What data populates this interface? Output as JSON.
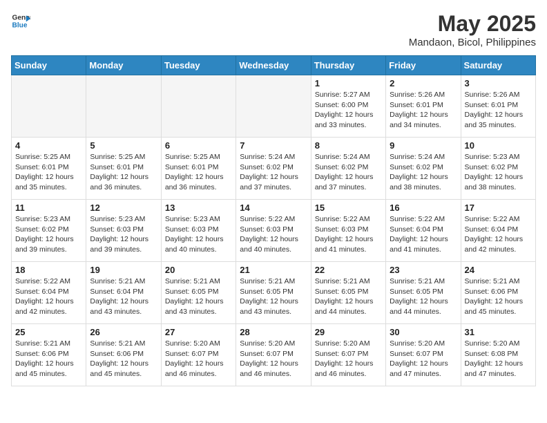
{
  "header": {
    "logo_line1": "General",
    "logo_line2": "Blue",
    "month": "May 2025",
    "location": "Mandaon, Bicol, Philippines"
  },
  "weekdays": [
    "Sunday",
    "Monday",
    "Tuesday",
    "Wednesday",
    "Thursday",
    "Friday",
    "Saturday"
  ],
  "weeks": [
    [
      {
        "day": "",
        "info": ""
      },
      {
        "day": "",
        "info": ""
      },
      {
        "day": "",
        "info": ""
      },
      {
        "day": "",
        "info": ""
      },
      {
        "day": "1",
        "info": "Sunrise: 5:27 AM\nSunset: 6:00 PM\nDaylight: 12 hours\nand 33 minutes."
      },
      {
        "day": "2",
        "info": "Sunrise: 5:26 AM\nSunset: 6:01 PM\nDaylight: 12 hours\nand 34 minutes."
      },
      {
        "day": "3",
        "info": "Sunrise: 5:26 AM\nSunset: 6:01 PM\nDaylight: 12 hours\nand 35 minutes."
      }
    ],
    [
      {
        "day": "4",
        "info": "Sunrise: 5:25 AM\nSunset: 6:01 PM\nDaylight: 12 hours\nand 35 minutes."
      },
      {
        "day": "5",
        "info": "Sunrise: 5:25 AM\nSunset: 6:01 PM\nDaylight: 12 hours\nand 36 minutes."
      },
      {
        "day": "6",
        "info": "Sunrise: 5:25 AM\nSunset: 6:01 PM\nDaylight: 12 hours\nand 36 minutes."
      },
      {
        "day": "7",
        "info": "Sunrise: 5:24 AM\nSunset: 6:02 PM\nDaylight: 12 hours\nand 37 minutes."
      },
      {
        "day": "8",
        "info": "Sunrise: 5:24 AM\nSunset: 6:02 PM\nDaylight: 12 hours\nand 37 minutes."
      },
      {
        "day": "9",
        "info": "Sunrise: 5:24 AM\nSunset: 6:02 PM\nDaylight: 12 hours\nand 38 minutes."
      },
      {
        "day": "10",
        "info": "Sunrise: 5:23 AM\nSunset: 6:02 PM\nDaylight: 12 hours\nand 38 minutes."
      }
    ],
    [
      {
        "day": "11",
        "info": "Sunrise: 5:23 AM\nSunset: 6:02 PM\nDaylight: 12 hours\nand 39 minutes."
      },
      {
        "day": "12",
        "info": "Sunrise: 5:23 AM\nSunset: 6:03 PM\nDaylight: 12 hours\nand 39 minutes."
      },
      {
        "day": "13",
        "info": "Sunrise: 5:23 AM\nSunset: 6:03 PM\nDaylight: 12 hours\nand 40 minutes."
      },
      {
        "day": "14",
        "info": "Sunrise: 5:22 AM\nSunset: 6:03 PM\nDaylight: 12 hours\nand 40 minutes."
      },
      {
        "day": "15",
        "info": "Sunrise: 5:22 AM\nSunset: 6:03 PM\nDaylight: 12 hours\nand 41 minutes."
      },
      {
        "day": "16",
        "info": "Sunrise: 5:22 AM\nSunset: 6:04 PM\nDaylight: 12 hours\nand 41 minutes."
      },
      {
        "day": "17",
        "info": "Sunrise: 5:22 AM\nSunset: 6:04 PM\nDaylight: 12 hours\nand 42 minutes."
      }
    ],
    [
      {
        "day": "18",
        "info": "Sunrise: 5:22 AM\nSunset: 6:04 PM\nDaylight: 12 hours\nand 42 minutes."
      },
      {
        "day": "19",
        "info": "Sunrise: 5:21 AM\nSunset: 6:04 PM\nDaylight: 12 hours\nand 43 minutes."
      },
      {
        "day": "20",
        "info": "Sunrise: 5:21 AM\nSunset: 6:05 PM\nDaylight: 12 hours\nand 43 minutes."
      },
      {
        "day": "21",
        "info": "Sunrise: 5:21 AM\nSunset: 6:05 PM\nDaylight: 12 hours\nand 43 minutes."
      },
      {
        "day": "22",
        "info": "Sunrise: 5:21 AM\nSunset: 6:05 PM\nDaylight: 12 hours\nand 44 minutes."
      },
      {
        "day": "23",
        "info": "Sunrise: 5:21 AM\nSunset: 6:05 PM\nDaylight: 12 hours\nand 44 minutes."
      },
      {
        "day": "24",
        "info": "Sunrise: 5:21 AM\nSunset: 6:06 PM\nDaylight: 12 hours\nand 45 minutes."
      }
    ],
    [
      {
        "day": "25",
        "info": "Sunrise: 5:21 AM\nSunset: 6:06 PM\nDaylight: 12 hours\nand 45 minutes."
      },
      {
        "day": "26",
        "info": "Sunrise: 5:21 AM\nSunset: 6:06 PM\nDaylight: 12 hours\nand 45 minutes."
      },
      {
        "day": "27",
        "info": "Sunrise: 5:20 AM\nSunset: 6:07 PM\nDaylight: 12 hours\nand 46 minutes."
      },
      {
        "day": "28",
        "info": "Sunrise: 5:20 AM\nSunset: 6:07 PM\nDaylight: 12 hours\nand 46 minutes."
      },
      {
        "day": "29",
        "info": "Sunrise: 5:20 AM\nSunset: 6:07 PM\nDaylight: 12 hours\nand 46 minutes."
      },
      {
        "day": "30",
        "info": "Sunrise: 5:20 AM\nSunset: 6:07 PM\nDaylight: 12 hours\nand 47 minutes."
      },
      {
        "day": "31",
        "info": "Sunrise: 5:20 AM\nSunset: 6:08 PM\nDaylight: 12 hours\nand 47 minutes."
      }
    ]
  ]
}
